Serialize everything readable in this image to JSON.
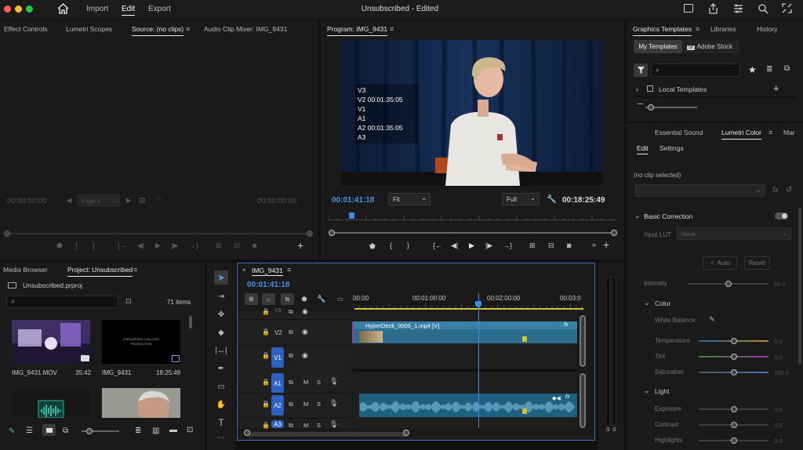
{
  "app": {
    "title": "Unsubscribed - Edited",
    "menu": [
      {
        "label": "Import"
      },
      {
        "label": "Edit"
      },
      {
        "label": "Export"
      }
    ]
  },
  "source": {
    "tabs": [
      {
        "label": "Effect Controls"
      },
      {
        "label": "Lumetri Scopes"
      },
      {
        "label": "Source: (no clips)"
      },
      {
        "label": "Audio Clip Mixer: IMG_9431"
      }
    ],
    "tc_left": "00:00:00:00",
    "tc_right": "00:00:00:00",
    "page": "Page 1"
  },
  "program": {
    "tab": "Program: IMG_9431",
    "overlay": [
      "V3",
      "V2 00:01:35:05",
      "V1",
      "A1",
      "A2 00:01:35:05",
      "A3"
    ],
    "tc": "00:01:41:18",
    "fit": "Fit",
    "quality": "Full",
    "duration": "00:18:25:49",
    "playhead": 0.08
  },
  "right": {
    "tabs": [
      {
        "label": "Graphics Templates"
      },
      {
        "label": "Libraries"
      },
      {
        "label": "History"
      }
    ],
    "my_templates": "My Templates",
    "adobe_stock": "Adobe Stock",
    "stock_badge": "St",
    "local_templates": "Local Templates",
    "tabs2": [
      {
        "label": "Essential Sound"
      },
      {
        "label": "Lumetri Color"
      },
      {
        "label": "Mar"
      }
    ],
    "edit_tab": "Edit",
    "settings_tab": "Settings",
    "no_clip": "(no clip selected)",
    "basic_correction": "Basic Correction",
    "input_lut_label": "Input LUT",
    "input_lut_value": "None",
    "auto": "Auto",
    "reset": "Reset",
    "intensity": {
      "label": "Intensity",
      "value": "50.0",
      "level": 0.5
    },
    "color": "Color",
    "white_balance": "White Balance",
    "temperature": {
      "label": "Temperature",
      "value": "0.0",
      "level": 0.5
    },
    "tint": {
      "label": "Tint",
      "value": "0.0",
      "level": 0.5
    },
    "saturation": {
      "label": "Saturation",
      "value": "100.0",
      "level": 0.5
    },
    "light": "Light",
    "exposure": {
      "label": "Exposure",
      "value": "0.0",
      "level": 0.5
    },
    "contrast": {
      "label": "Contrast",
      "value": "0.0",
      "level": 0.5
    },
    "highlights": {
      "label": "Highlights",
      "value": "0.0",
      "level": 0.5
    }
  },
  "project": {
    "tabs": [
      {
        "label": "Media Browser"
      },
      {
        "label": "Project: Unsubscribed"
      }
    ],
    "file": "Unsubscribed.prproj",
    "count": "71 items",
    "items": [
      {
        "name": "IMG_9431.MOV",
        "duration": "35:42"
      },
      {
        "name": "IMG_9431",
        "duration": "18:25:49",
        "caption": "A BRADFORD COLLEGE\nPRODUCTION"
      }
    ]
  },
  "timeline": {
    "tab": "IMG_9431",
    "tc": "00:01:41:18",
    "ruler": [
      "00:00",
      "00:01:00:00",
      "00:02:00:00",
      "00:03:0"
    ],
    "clip_name": "HyperDeck_0005_1.mp4 [V]",
    "fx": "fx",
    "tracks": {
      "v3": "V3",
      "v2": "V2",
      "v1": "V1",
      "a1": "A1",
      "a2": "A2",
      "a3": "A3",
      "m": "M",
      "s": "S"
    },
    "playhead": 0.56
  },
  "meter": {
    "labels": [
      "S",
      "S"
    ]
  },
  "colors": {
    "accent": "#2d8ceb",
    "clip": "#2d6f93",
    "audio": "#1f5f80",
    "yellow": "#d6c23a"
  }
}
